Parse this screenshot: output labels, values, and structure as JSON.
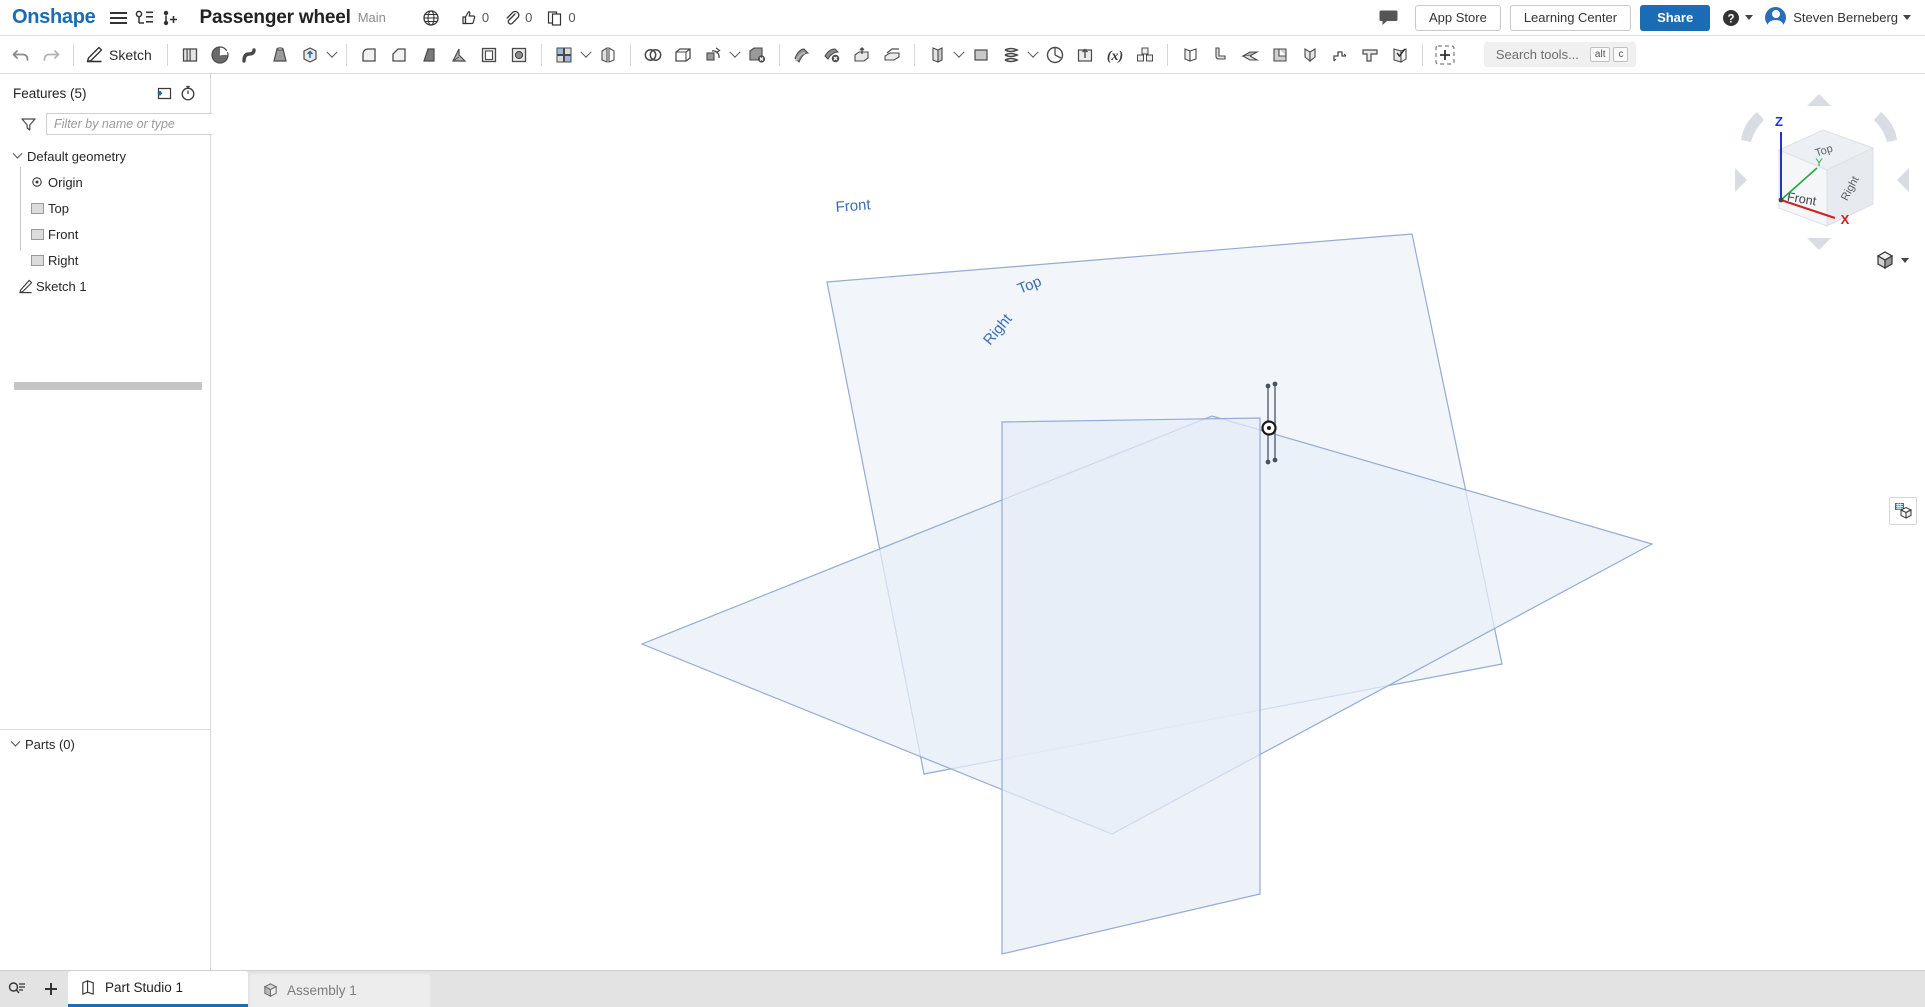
{
  "topbar": {
    "brand": "Onshape",
    "menu_icon": "hamburger-icon",
    "document_title": "Passenger wheel",
    "branch": "Main",
    "visibility_icon": "globe-icon",
    "stats": [
      {
        "icon": "thumbs-up-icon",
        "value": "0",
        "name": "likes-count"
      },
      {
        "icon": "paperclip-icon",
        "value": "0",
        "name": "attachments-count"
      },
      {
        "icon": "copies-icon",
        "value": "0",
        "name": "copies-count"
      }
    ],
    "comment_icon": "comment-icon",
    "app_store_label": "App Store",
    "learning_center_label": "Learning Center",
    "share_label": "Share",
    "help_icon": "help-icon",
    "user_name": "Steven Berneberg"
  },
  "toolbar": {
    "undo_icon": "undo-icon",
    "redo_icon": "redo-icon",
    "sketch_label": "Sketch",
    "sketch_icon": "sketch-pencil-icon",
    "tools": [
      "extrude-icon",
      "revolve-icon",
      "sweep-icon",
      "loft-icon",
      "thicken-icon",
      "fillet-icon",
      "chamfer-icon",
      "draft-icon",
      "rib-icon",
      "shell-icon",
      "hole-icon",
      "linear-pattern-icon",
      "mirror-icon",
      "boolean-icon",
      "enclose-icon",
      "transform-icon",
      "delete-part-icon",
      "split-icon",
      "delete-face-icon",
      "move-face-icon",
      "replace-face-icon",
      "plane-icon",
      "sketch-plane-icon",
      "helix-icon",
      "curve-icon",
      "import-icon",
      "variable-icon",
      "composite-part-icon",
      "sheet-metal-icon",
      "flange-icon",
      "hem-icon",
      "tab-icon",
      "bend-icon",
      "joint-icon",
      "corner-icon",
      "sheet-model-icon"
    ],
    "add_tool_icon": "add-custom-feature-icon",
    "search_placeholder": "Search tools...",
    "search_shortcut_alt": "alt",
    "search_shortcut_key": "c"
  },
  "features_panel": {
    "title": "Features (5)",
    "new_folder_icon": "new-folder-icon",
    "rollback_icon": "measure-timer-icon",
    "filter_icon": "filter-funnel-icon",
    "filter_placeholder": "Filter by name or type",
    "tree": [
      {
        "label": "Default geometry",
        "icon": "folder-group",
        "expanded": true,
        "children": [
          {
            "label": "Origin",
            "icon": "origin-icon"
          },
          {
            "label": "Top",
            "icon": "plane-icon"
          },
          {
            "label": "Front",
            "icon": "plane-icon"
          },
          {
            "label": "Right",
            "icon": "plane-icon"
          }
        ]
      },
      {
        "label": "Sketch 1",
        "icon": "sketch-pencil-icon",
        "expanded": false,
        "children": []
      }
    ],
    "parts_label": "Parts (0)",
    "panel_toggle_icon": "list-panel-icon"
  },
  "viewport": {
    "planes": [
      {
        "name": "Front",
        "label": "Front"
      },
      {
        "name": "Top",
        "label": "Top"
      },
      {
        "name": "Right",
        "label": "Right"
      }
    ],
    "origin_marker": "origin-point",
    "background_color": "#ffffff",
    "plane_fill": "#eef3fa",
    "plane_stroke": "#9ab0d4",
    "label_color": "#3b6bb5",
    "viewcube": {
      "faces": {
        "top": "Top",
        "front": "Front",
        "right": "Right"
      },
      "axes": {
        "z": "Z",
        "x": "X",
        "y": "Y"
      },
      "axis_colors": {
        "z": "#2233cc",
        "x": "#cc2222",
        "y": "#22aa44"
      }
    },
    "view_style_icon": "shaded-cube-icon",
    "right_tool_icon": "display-state-icon"
  },
  "tabbar": {
    "search_tabs_icon": "tab-search-icon",
    "add_tab_icon": "add-tab-icon",
    "tabs": [
      {
        "label": "Part Studio 1",
        "icon": "part-studio-icon",
        "active": true
      },
      {
        "label": "Assembly 1",
        "icon": "assembly-icon",
        "active": false
      }
    ]
  }
}
